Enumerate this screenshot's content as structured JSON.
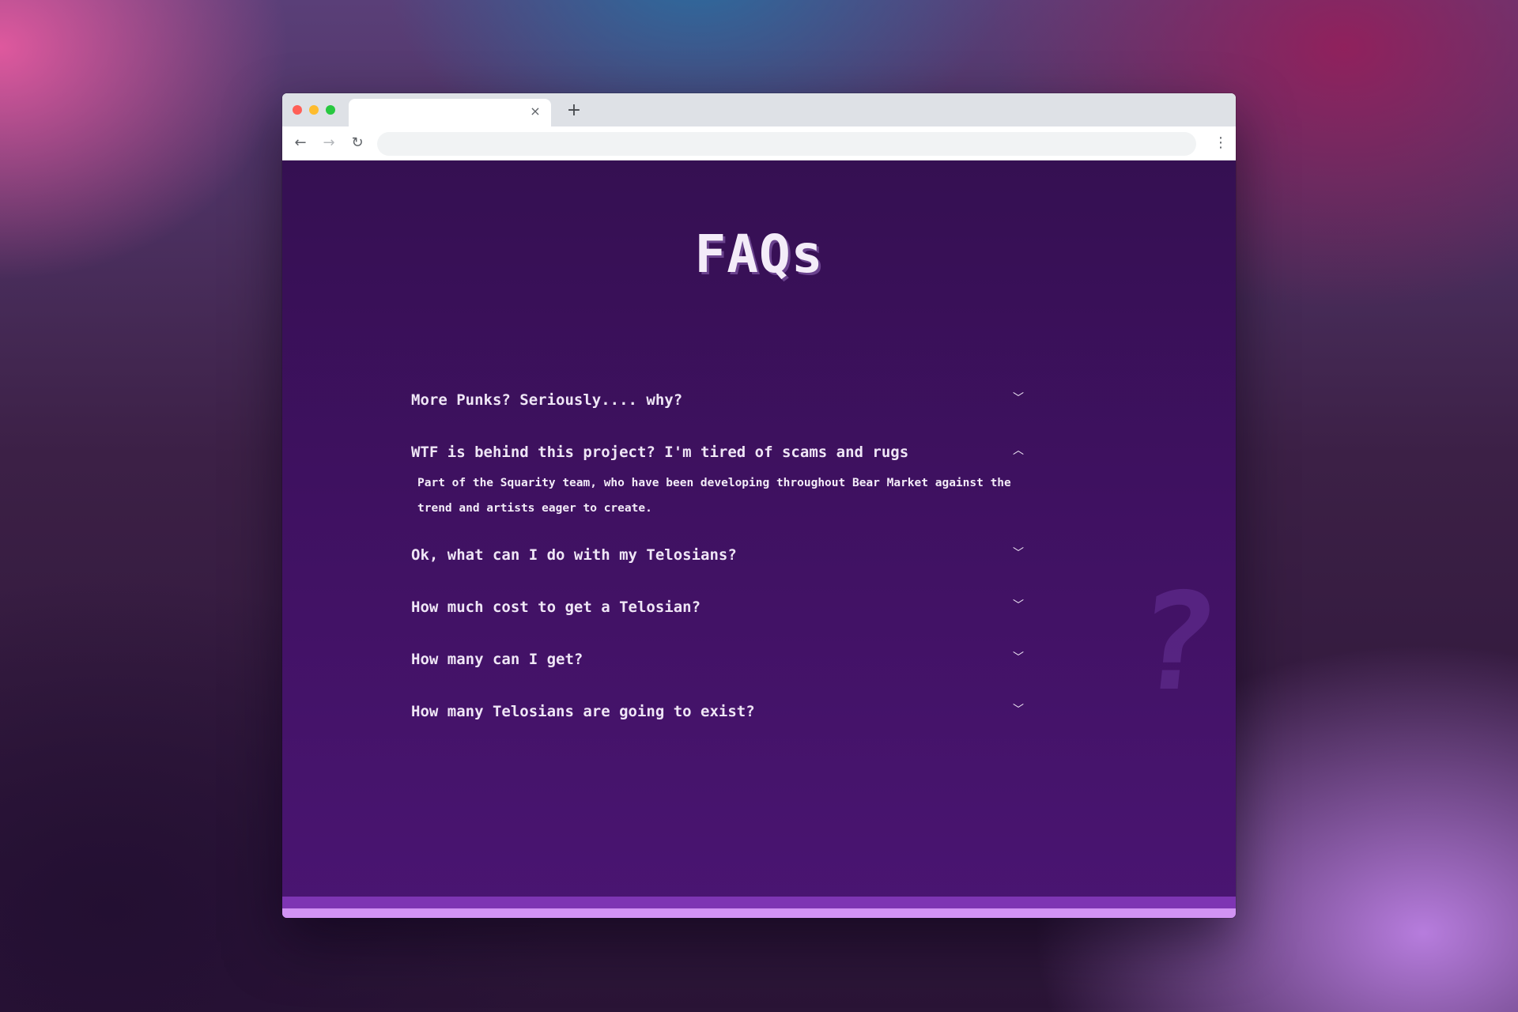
{
  "browser": {
    "tab_title": "",
    "tab_close": "×",
    "new_tab": "+",
    "address": "",
    "back": "←",
    "forward": "→",
    "reload": "↻",
    "menu": "⋮",
    "traffic_colors": {
      "red": "#ff5f57",
      "yellow": "#febc2e",
      "green": "#28c840"
    }
  },
  "page": {
    "title": "FAQs",
    "background_question_mark": "?",
    "colors": {
      "background": "#3f1161",
      "text": "#efe6f6",
      "footer_bar": "#7e35b3",
      "footer_bar_light": "#d293f4"
    }
  },
  "faqs": [
    {
      "question": "More Punks? Seriously.... why?",
      "expanded": false,
      "icon": "chevron-down-icon",
      "toggle": "﹀"
    },
    {
      "question": "WTF is behind this project? I'm tired of scams and rugs",
      "expanded": true,
      "icon": "chevron-up-icon",
      "toggle": "︿",
      "answer": "Part of the Squarity team, who have been developing throughout Bear Market against the trend and artists eager to create."
    },
    {
      "question": "Ok, what can I do with my Telosians?",
      "expanded": false,
      "icon": "chevron-down-icon",
      "toggle": "﹀"
    },
    {
      "question": "How much cost to get a Telosian?",
      "expanded": false,
      "icon": "chevron-down-icon",
      "toggle": "﹀"
    },
    {
      "question": "How many can I get?",
      "expanded": false,
      "icon": "chevron-down-icon",
      "toggle": "﹀"
    },
    {
      "question": "How many Telosians are going to exist?",
      "expanded": false,
      "icon": "chevron-down-icon",
      "toggle": "﹀"
    }
  ]
}
